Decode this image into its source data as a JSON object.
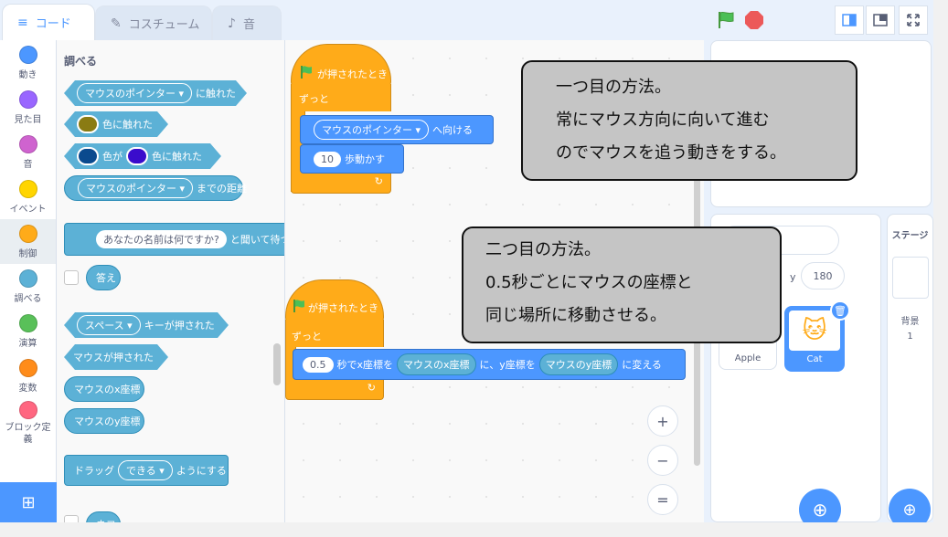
{
  "tabs": [
    {
      "label": "コード",
      "icon": "code-icon"
    },
    {
      "label": "コスチューム",
      "icon": "brush-icon"
    },
    {
      "label": "音",
      "icon": "speaker-icon"
    }
  ],
  "categories": [
    {
      "label": "動き",
      "color": "#4c97ff"
    },
    {
      "label": "見た目",
      "color": "#9966ff"
    },
    {
      "label": "音",
      "color": "#cf63cf"
    },
    {
      "label": "イベント",
      "color": "#ffd500"
    },
    {
      "label": "制御",
      "color": "#ffab19"
    },
    {
      "label": "調べる",
      "color": "#5cb1d6"
    },
    {
      "label": "演算",
      "color": "#59c059"
    },
    {
      "label": "変数",
      "color": "#ff8c1a"
    },
    {
      "label": "ブロック定義",
      "color": "#ff6680"
    }
  ],
  "palette": {
    "title": "調べる",
    "blk_touching_drop": "マウスのポインター",
    "blk_touching_text": "に触れた",
    "blk_color_text": "色に触れた",
    "blk_colorcolor_a": "色が",
    "blk_colorcolor_b": "色に触れた",
    "blk_distance_drop": "マウスのポインター",
    "blk_distance_text": "までの距離",
    "blk_ask_input": "あなたの名前は何ですか?",
    "blk_ask_text": "と聞いて待つ",
    "blk_answer": "答え",
    "blk_key_drop": "スペース",
    "blk_key_text": "キーが押された",
    "blk_mouse_down": "マウスが押された",
    "blk_mouse_x": "マウスのx座標",
    "blk_mouse_y": "マウスのy座標",
    "blk_drag_a": "ドラッグ",
    "blk_drag_drop": "できる",
    "blk_drag_b": "ようにする",
    "blk_partial": "ネコ"
  },
  "script1": {
    "hat": "が押されたとき",
    "forever": "ずっと",
    "point_drop": "マウスのポインター",
    "point_text": "へ向ける",
    "move_value": "10",
    "move_text": "歩動かす"
  },
  "script2": {
    "hat": "が押されたとき",
    "forever": "ずっと",
    "glide_value": "0.5",
    "glide_a": "秒でx座標を",
    "glide_x": "マウスのx座標",
    "glide_b": "に、y座標を",
    "glide_y": "マウスのy座標",
    "glide_c": "に変える"
  },
  "notes": {
    "first": [
      "一つ目の方法。",
      "常にマウス方向に向いて進む",
      "のでマウスを追う動きをする。"
    ],
    "second": [
      "二つ目の方法。",
      "0.5秒ごとにマウスの座標と",
      "同じ場所に移動させる。"
    ]
  },
  "sprite_info": {
    "y_label": "y",
    "y_value": "180"
  },
  "sprites": [
    {
      "name": "Apple"
    },
    {
      "name": "Cat"
    }
  ],
  "stage_pane": {
    "title": "ステージ",
    "backdrop_label": "背景",
    "backdrop_count": "1"
  },
  "zoom": {
    "in": "+",
    "out": "−",
    "reset": "="
  }
}
